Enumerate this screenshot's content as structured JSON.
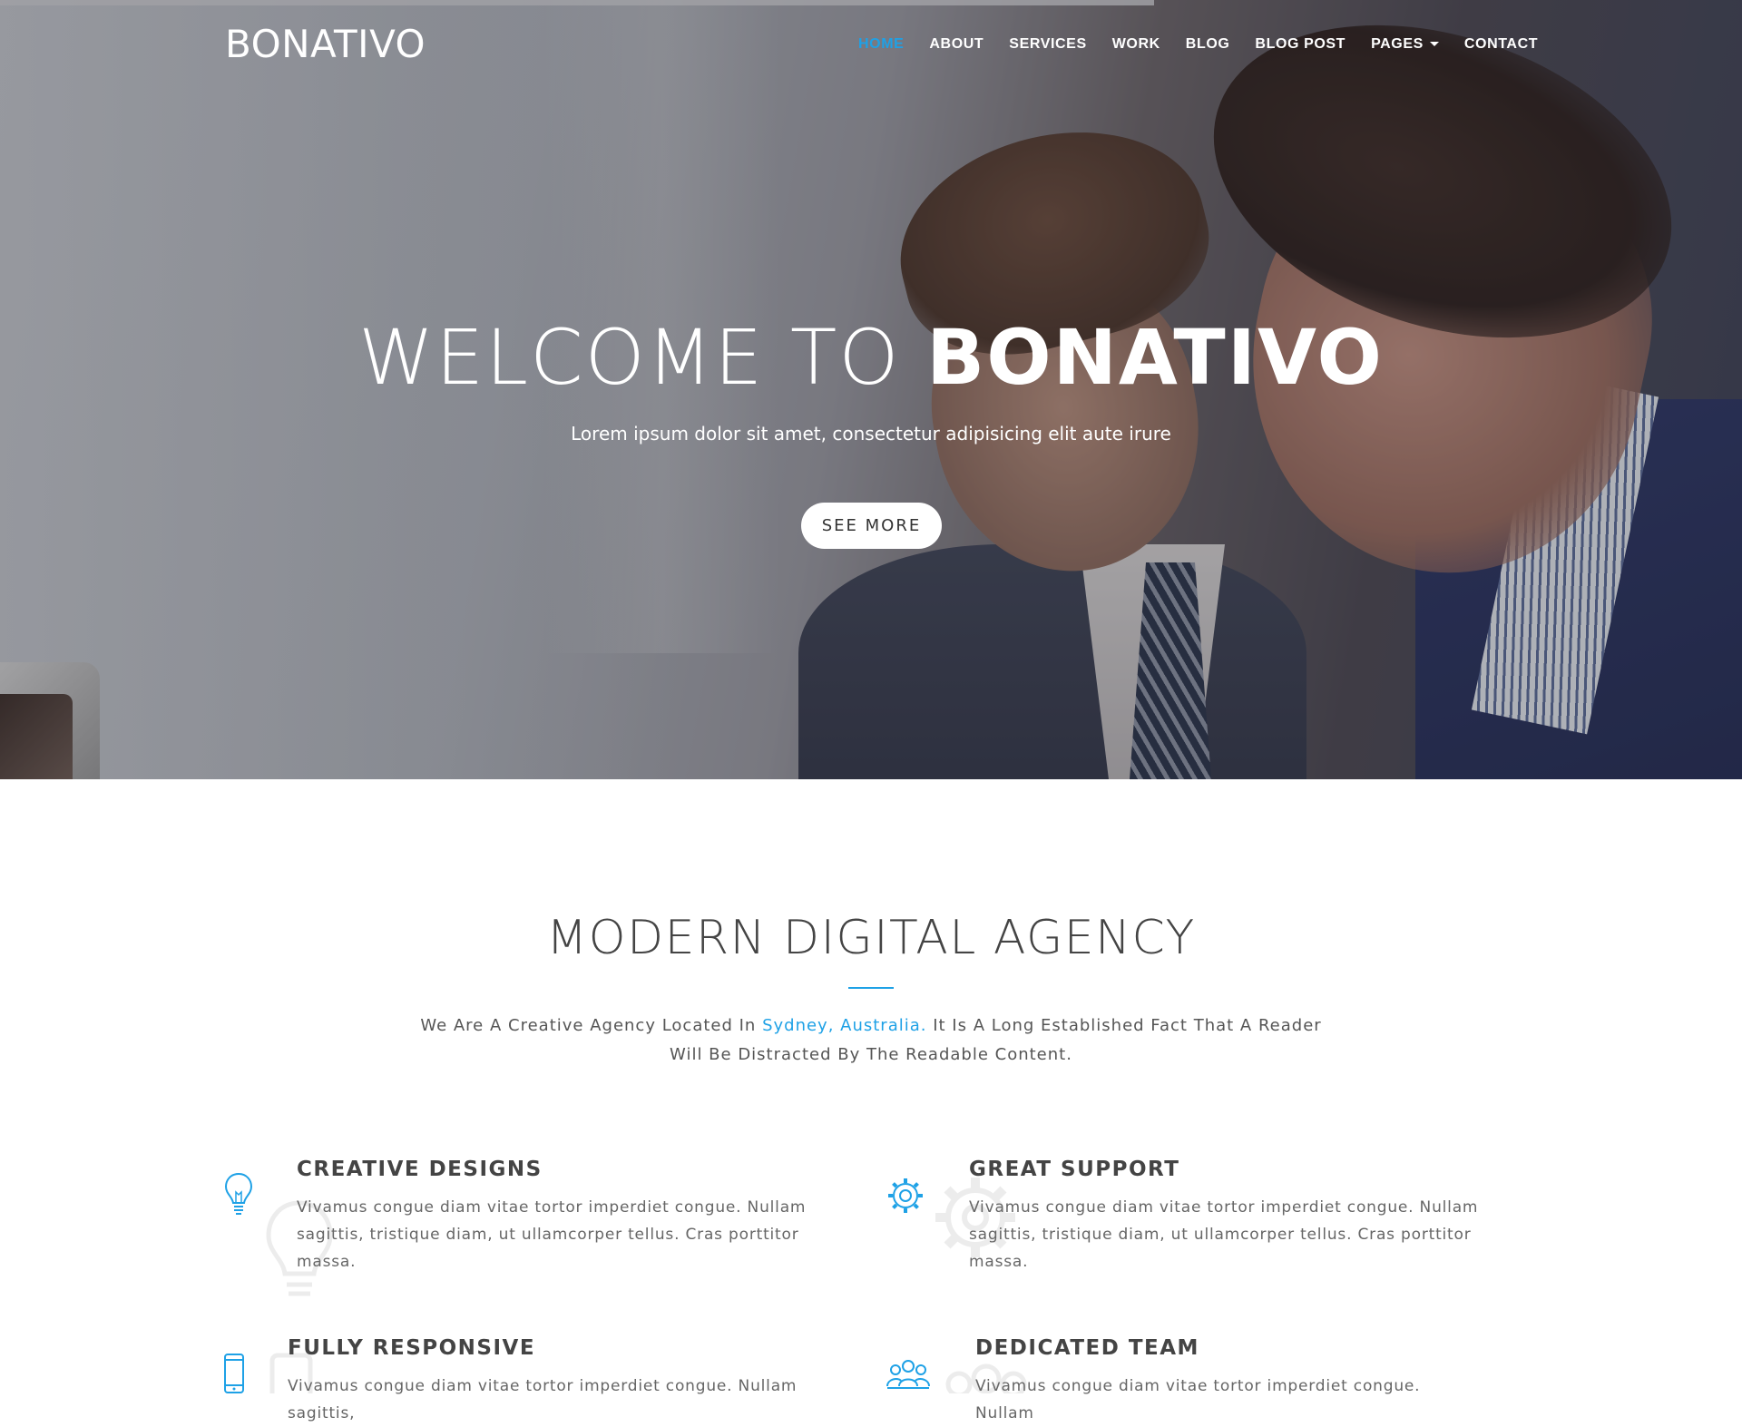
{
  "brand": {
    "logo": "BONATIVO",
    "accent_color": "#1ea1e6"
  },
  "nav": {
    "items": [
      {
        "label": "HOME",
        "active": true
      },
      {
        "label": "ABOUT",
        "active": false
      },
      {
        "label": "SERVICES",
        "active": false
      },
      {
        "label": "WORK",
        "active": false
      },
      {
        "label": "BLOG",
        "active": false
      },
      {
        "label": "BLOG POST",
        "active": false
      },
      {
        "label": "PAGES",
        "active": false,
        "dropdown": true
      },
      {
        "label": "CONTACT",
        "active": false
      }
    ]
  },
  "hero": {
    "title_light": "WELCOME TO ",
    "title_bold": "BONATIVO",
    "subtitle": "Lorem ipsum dolor sit amet, consectetur adipisicing elit aute irure",
    "button_label": "SEE MORE"
  },
  "about": {
    "title": "MODERN DIGITAL AGENCY",
    "text_before": "We Are A Creative Agency Located In ",
    "text_link": "Sydney, Australia.",
    "text_after_line1": " It Is A Long Established Fact That A Reader",
    "text_line2": "Will Be Distracted By The Readable Content."
  },
  "features": [
    {
      "icon": "lightbulb-icon",
      "title": "CREATIVE DESIGNS",
      "text": "Vivamus congue diam vitae tortor imperdiet congue. Nullam sagittis, tristique diam, ut ullamcorper tellus. Cras porttitor massa."
    },
    {
      "icon": "gear-icon",
      "title": "GREAT SUPPORT",
      "text": "Vivamus congue diam vitae tortor imperdiet congue. Nullam sagittis, tristique diam, ut ullamcorper tellus. Cras porttitor massa."
    },
    {
      "icon": "mobile-icon",
      "title": "FULLY RESPONSIVE",
      "text": "Vivamus congue diam vitae tortor imperdiet congue. Nullam sagittis,"
    },
    {
      "icon": "team-icon",
      "title": "DEDICATED TEAM",
      "text": "Vivamus congue diam vitae tortor imperdiet congue. Nullam"
    }
  ]
}
